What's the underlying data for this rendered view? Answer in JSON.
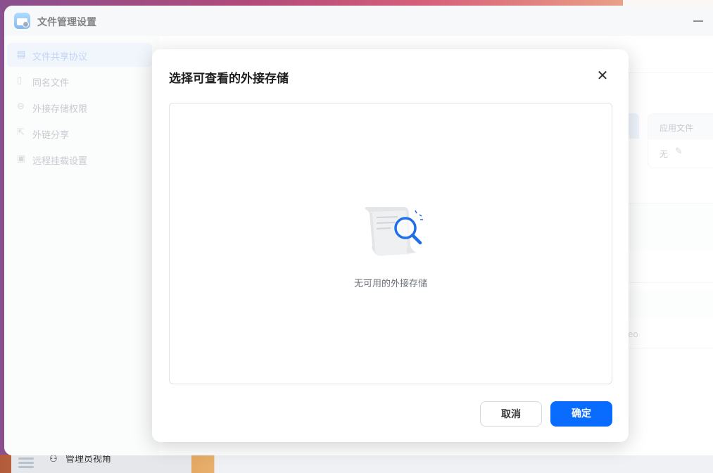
{
  "window": {
    "title": "文件管理设置"
  },
  "sidebar": {
    "items": [
      {
        "label": "文件共享协议",
        "icon": "document-icon"
      },
      {
        "label": "同名文件",
        "icon": "file-icon"
      },
      {
        "label": "外接存储权限",
        "icon": "drive-icon"
      },
      {
        "label": "外链分享",
        "icon": "share-icon"
      },
      {
        "label": "远程挂载设置",
        "icon": "folder-icon"
      }
    ]
  },
  "background_card": {
    "header": "应用文件",
    "value": "无"
  },
  "background_fragment": "eo",
  "dialog": {
    "title": "选择可查看的外接存储",
    "empty_text": "无可用的外接存储",
    "cancel_label": "取消",
    "ok_label": "确定"
  },
  "taskbar": {
    "label": "管理员视角"
  },
  "colors": {
    "accent": "#0a6cff"
  }
}
